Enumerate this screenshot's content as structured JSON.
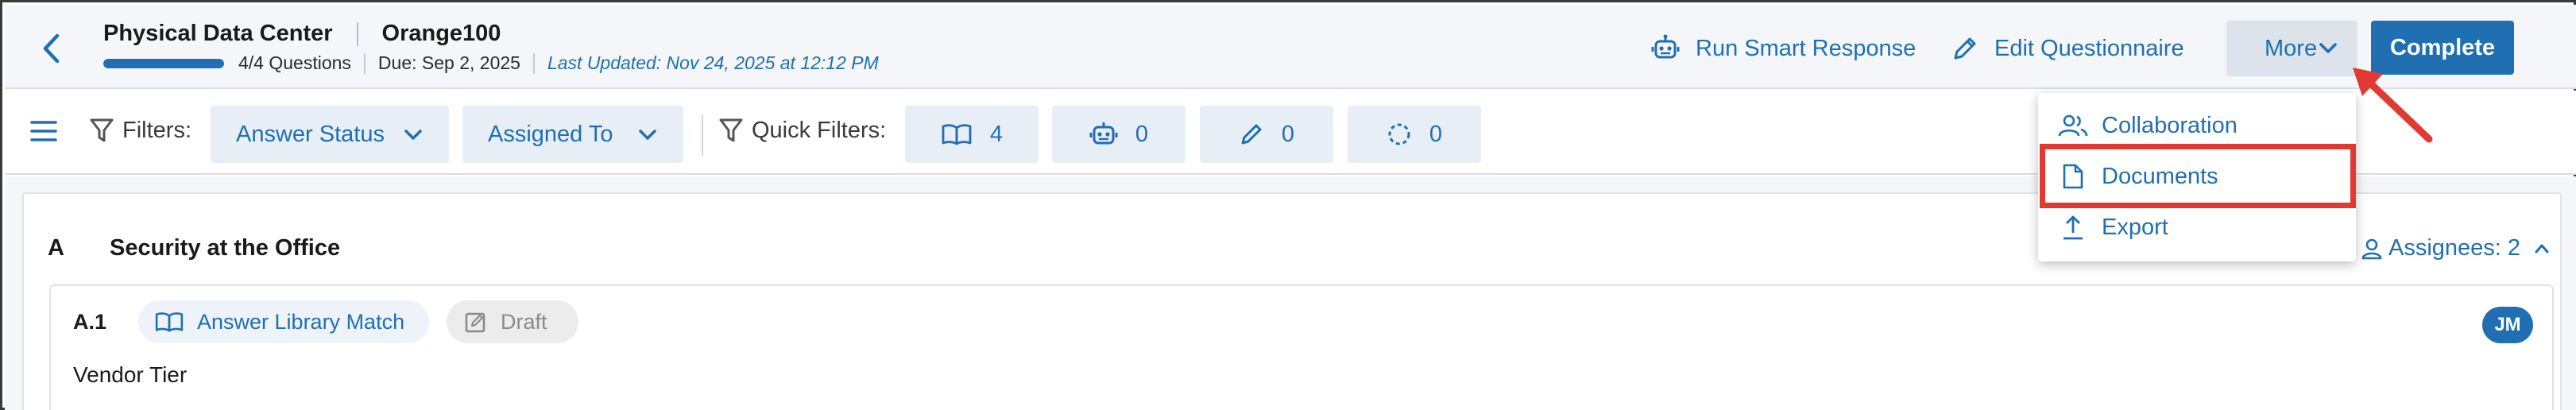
{
  "header": {
    "title": "Physical Data Center",
    "subtitle": "Orange100",
    "questions": "4/4 Questions",
    "progress_fraction": 1.0,
    "due": "Due: Sep 2, 2025",
    "last_updated": "Last Updated: Nov 24, 2025 at 12:12 PM",
    "run_smart_response": "Run Smart Response",
    "edit_questionnaire": "Edit Questionnaire",
    "more": "More",
    "complete": "Complete"
  },
  "filterbar": {
    "filters_label": "Filters:",
    "answer_status": "Answer Status",
    "assigned_to": "Assigned To",
    "quick_filters_label": "Quick Filters:",
    "quick_filters": [
      {
        "icon": "book-icon",
        "count": "4"
      },
      {
        "icon": "robot-icon",
        "count": "0"
      },
      {
        "icon": "pencil-icon",
        "count": "0"
      },
      {
        "icon": "dashed-circle-icon",
        "count": "0"
      }
    ]
  },
  "section": {
    "letter": "A",
    "title": "Security at the Office",
    "assignees": "Assignees: 2"
  },
  "question": {
    "number": "A.1",
    "library_chip": "Answer Library Match",
    "status_chip": "Draft",
    "avatar": "JM",
    "text": "Vendor Tier"
  },
  "more_menu": {
    "items": [
      {
        "label": "Collaboration",
        "icon": "people-icon"
      },
      {
        "label": "Documents",
        "icon": "document-icon"
      },
      {
        "label": "Export",
        "icon": "upload-icon"
      }
    ]
  },
  "colors": {
    "accent": "#1f6fb2",
    "header_bg": "#f4f6f9",
    "chip_bg": "#e8eef5",
    "annotation_red": "#e03a32"
  }
}
